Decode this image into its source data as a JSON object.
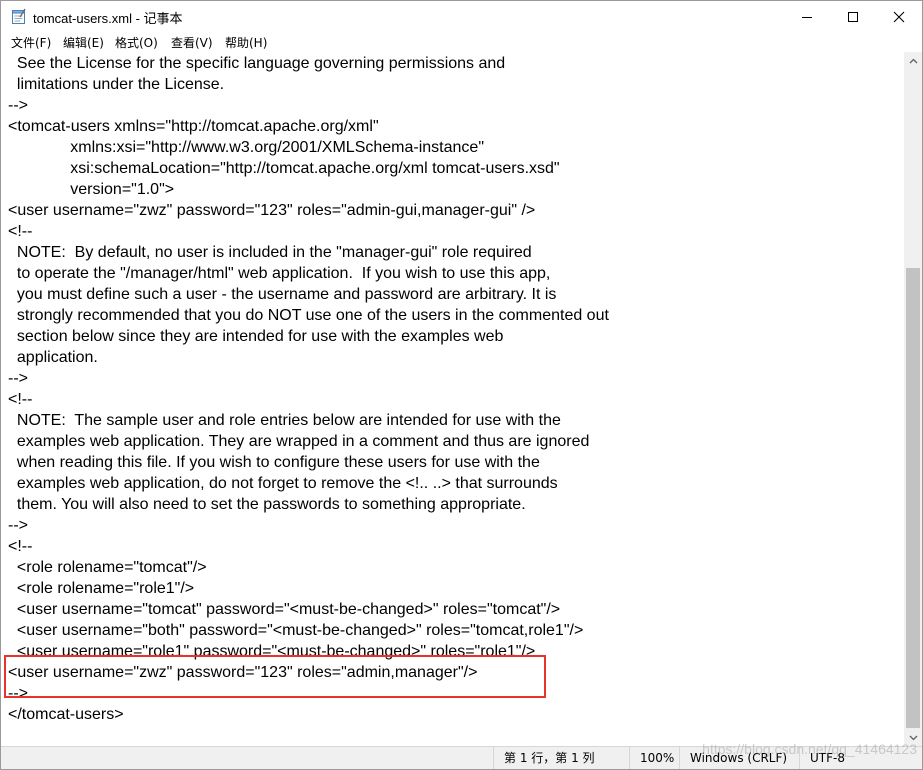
{
  "window": {
    "title": "tomcat-users.xml - 记事本",
    "controls": {
      "minimize": "minimize",
      "maximize": "maximize",
      "close": "close"
    }
  },
  "menu": {
    "items": [
      {
        "label": "文件(F)"
      },
      {
        "label": "编辑(E)"
      },
      {
        "label": "格式(O)"
      },
      {
        "label": "查看(V)"
      },
      {
        "label": "帮助(H)"
      }
    ]
  },
  "editor": {
    "text": "  See the License for the specific language governing permissions and\n  limitations under the License.\n-->\n<tomcat-users xmlns=\"http://tomcat.apache.org/xml\"\n              xmlns:xsi=\"http://www.w3.org/2001/XMLSchema-instance\"\n              xsi:schemaLocation=\"http://tomcat.apache.org/xml tomcat-users.xsd\"\n              version=\"1.0\">\n<user username=\"zwz\" password=\"123\" roles=\"admin-gui,manager-gui\" />\n<!--\n  NOTE:  By default, no user is included in the \"manager-gui\" role required\n  to operate the \"/manager/html\" web application.  If you wish to use this app,\n  you must define such a user - the username and password are arbitrary. It is\n  strongly recommended that you do NOT use one of the users in the commented out\n  section below since they are intended for use with the examples web\n  application.\n-->\n<!--\n  NOTE:  The sample user and role entries below are intended for use with the\n  examples web application. They are wrapped in a comment and thus are ignored\n  when reading this file. If you wish to configure these users for use with the\n  examples web application, do not forget to remove the <!.. ..> that surrounds\n  them. You will also need to set the passwords to something appropriate.\n-->\n<!--\n  <role rolename=\"tomcat\"/>\n  <role rolename=\"role1\"/>\n  <user username=\"tomcat\" password=\"<must-be-changed>\" roles=\"tomcat\"/>\n  <user username=\"both\" password=\"<must-be-changed>\" roles=\"tomcat,role1\"/>\n  <user username=\"role1\" password=\"<must-be-changed>\" roles=\"role1\"/>\n<user username=\"zwz\" password=\"123\" roles=\"admin,manager\"/>\n-->\n</tomcat-users>"
  },
  "statusbar": {
    "position": "第 1 行，第 1 列",
    "zoom": "100%",
    "line_ending": "Windows (CRLF)",
    "encoding": "UTF-8"
  },
  "watermark": "https://blog.csdn.net/qq_41464123",
  "annotation": {
    "color": "#e8332a"
  }
}
